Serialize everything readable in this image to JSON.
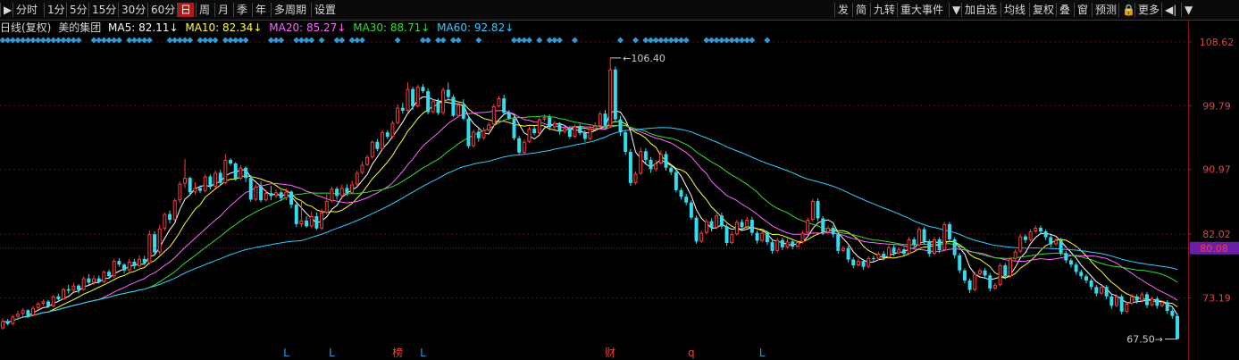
{
  "toolbar": {
    "left_items": [
      "分时",
      "1分",
      "5分",
      "15分",
      "30分",
      "60分",
      "日",
      "周",
      "月",
      "季",
      "年",
      "多周期",
      "设置"
    ],
    "active": "日",
    "right_items": [
      "发",
      "简",
      "九转",
      "重大事件",
      "加自选",
      "均线",
      "复权",
      "叠",
      "窗",
      "预测",
      "更多"
    ]
  },
  "info": {
    "period": "日线(复权)",
    "stock_name": "美的集团",
    "ma": [
      {
        "label": "MA5: 82.11↓",
        "color": "#ffffff"
      },
      {
        "label": "MA10: 82.34↓",
        "color": "#ffff33"
      },
      {
        "label": "MA20: 85.27↓",
        "color": "#ff66ff"
      },
      {
        "label": "MA30: 88.71↓",
        "color": "#33dd33"
      },
      {
        "label": "MA60: 92.82↓",
        "color": "#33ccff"
      }
    ]
  },
  "chart_data": {
    "type": "candlestick",
    "y_ticks": [
      "108.62",
      "99.79",
      "90.97",
      "82.02",
      "73.19"
    ],
    "ylim": [
      64.6,
      111.7
    ],
    "current_price": "80.08",
    "high_annotation": "106.40",
    "low_annotation": "67.50",
    "bottom_markers": [
      {
        "label": "L",
        "index": 56
      },
      {
        "label": "L",
        "index": 65
      },
      {
        "label": "榜",
        "index": 78
      },
      {
        "label": "L",
        "index": 83
      },
      {
        "label": "财",
        "index": 120
      },
      {
        "label": "q",
        "index": 136
      },
      {
        "label": "L",
        "index": 150
      }
    ],
    "diamond_indices": [
      0,
      1,
      2,
      3,
      4,
      5,
      6,
      7,
      8,
      9,
      10,
      11,
      12,
      13,
      14,
      15,
      18,
      19,
      20,
      21,
      22,
      23,
      25,
      26,
      27,
      28,
      29,
      33,
      34,
      35,
      36,
      37,
      39,
      40,
      41,
      42,
      44,
      45,
      46,
      47,
      48,
      53,
      54,
      55,
      58,
      59,
      60,
      61,
      63,
      66,
      67,
      69,
      70,
      71,
      78,
      83,
      84,
      86,
      87,
      89,
      90,
      94,
      101,
      102,
      103,
      104,
      106,
      108,
      109,
      110,
      113,
      122,
      125,
      127,
      128,
      129,
      130,
      131,
      132,
      133,
      134,
      135,
      139,
      140,
      141,
      142,
      143,
      144,
      145,
      146,
      147,
      148,
      151
    ],
    "candles": [
      [
        69.0,
        70.0,
        68.8,
        70.4
      ],
      [
        70.0,
        69.6,
        69.4,
        70.3
      ],
      [
        69.6,
        70.6,
        69.4,
        70.8
      ],
      [
        70.6,
        71.0,
        70.4,
        71.4
      ],
      [
        71.0,
        71.5,
        70.6,
        71.8
      ],
      [
        71.5,
        70.8,
        70.5,
        71.6
      ],
      [
        70.8,
        71.8,
        70.7,
        72.1
      ],
      [
        71.8,
        72.4,
        71.6,
        72.6
      ],
      [
        72.4,
        72.7,
        72.1,
        73.0
      ],
      [
        72.7,
        72.0,
        71.8,
        72.9
      ],
      [
        72.0,
        73.4,
        71.9,
        73.6
      ],
      [
        73.4,
        73.0,
        72.7,
        73.8
      ],
      [
        73.0,
        74.4,
        72.9,
        74.6
      ],
      [
        74.4,
        74.2,
        73.8,
        75.0
      ],
      [
        74.2,
        74.9,
        74.0,
        75.3
      ],
      [
        74.9,
        74.3,
        73.8,
        75.1
      ],
      [
        74.3,
        75.9,
        74.2,
        76.2
      ],
      [
        75.9,
        75.3,
        75.0,
        76.5
      ],
      [
        75.3,
        75.9,
        75.0,
        76.3
      ],
      [
        75.9,
        75.4,
        75.2,
        76.3
      ],
      [
        75.4,
        76.8,
        75.2,
        77.0
      ],
      [
        76.8,
        76.2,
        75.8,
        77.1
      ],
      [
        76.2,
        78.3,
        76.0,
        78.6
      ],
      [
        78.3,
        77.8,
        77.5,
        78.7
      ],
      [
        77.8,
        77.0,
        76.6,
        78.0
      ],
      [
        77.0,
        78.2,
        76.8,
        78.6
      ],
      [
        78.2,
        77.6,
        77.2,
        78.6
      ],
      [
        77.6,
        78.6,
        77.4,
        79.1
      ],
      [
        78.6,
        78.0,
        77.8,
        79.0
      ],
      [
        78.0,
        82.0,
        77.8,
        82.5
      ],
      [
        82.0,
        79.5,
        79.0,
        82.4
      ],
      [
        79.5,
        82.8,
        79.2,
        83.3
      ],
      [
        82.8,
        84.8,
        82.5,
        85.0
      ],
      [
        84.8,
        84.0,
        83.5,
        85.3
      ],
      [
        84.0,
        86.7,
        83.8,
        87.0
      ],
      [
        86.7,
        89.0,
        86.3,
        89.3
      ],
      [
        89.0,
        89.8,
        88.4,
        92.4
      ],
      [
        89.8,
        87.8,
        87.5,
        90.0
      ],
      [
        87.8,
        88.4,
        87.5,
        89.2
      ],
      [
        88.4,
        88.0,
        87.7,
        88.8
      ],
      [
        88.0,
        90.0,
        87.8,
        90.3
      ],
      [
        90.0,
        88.6,
        88.2,
        90.3
      ],
      [
        88.6,
        90.5,
        88.4,
        90.8
      ],
      [
        90.5,
        89.1,
        88.8,
        90.9
      ],
      [
        89.1,
        92.3,
        88.9,
        93.1
      ],
      [
        92.3,
        91.8,
        91.5,
        92.5
      ],
      [
        91.8,
        89.7,
        89.4,
        92.0
      ],
      [
        89.7,
        91.2,
        89.5,
        91.6
      ],
      [
        91.2,
        89.8,
        89.2,
        91.4
      ],
      [
        89.8,
        86.8,
        86.5,
        90.2
      ],
      [
        86.8,
        88.6,
        86.6,
        88.9
      ],
      [
        88.6,
        86.7,
        86.4,
        89.3
      ],
      [
        86.7,
        87.7,
        86.5,
        88.1
      ],
      [
        87.7,
        87.3,
        86.7,
        88.7
      ],
      [
        87.3,
        87.8,
        87.0,
        88.2
      ],
      [
        87.8,
        87.0,
        86.6,
        88.1
      ],
      [
        87.0,
        87.9,
        86.7,
        88.4
      ],
      [
        87.9,
        86.1,
        85.6,
        88.1
      ],
      [
        86.1,
        83.4,
        83.0,
        86.4
      ],
      [
        83.4,
        83.9,
        83.0,
        86.8
      ],
      [
        83.9,
        83.1,
        82.9,
        84.5
      ],
      [
        83.1,
        84.5,
        82.9,
        85.2
      ],
      [
        84.5,
        82.8,
        82.6,
        85.0
      ],
      [
        82.8,
        85.0,
        82.6,
        85.5
      ],
      [
        85.0,
        86.6,
        84.8,
        87.5
      ],
      [
        86.6,
        88.3,
        86.4,
        88.6
      ],
      [
        88.3,
        87.3,
        86.8,
        88.6
      ],
      [
        87.3,
        88.4,
        87.1,
        88.9
      ],
      [
        88.4,
        87.7,
        87.3,
        88.9
      ],
      [
        87.7,
        88.9,
        87.5,
        89.4
      ],
      [
        88.9,
        90.5,
        88.6,
        90.8
      ],
      [
        90.5,
        91.6,
        90.3,
        92.1
      ],
      [
        91.6,
        92.7,
        91.4,
        93.0
      ],
      [
        92.7,
        94.8,
        92.4,
        95.0
      ],
      [
        94.8,
        93.8,
        93.5,
        95.2
      ],
      [
        93.8,
        96.1,
        93.6,
        96.4
      ],
      [
        96.1,
        95.5,
        95.2,
        96.4
      ],
      [
        95.5,
        97.4,
        95.3,
        97.7
      ],
      [
        97.4,
        99.5,
        97.2,
        100.0
      ],
      [
        99.5,
        99.1,
        98.7,
        100.2
      ],
      [
        99.1,
        102.1,
        98.9,
        103.0
      ],
      [
        102.1,
        99.7,
        99.2,
        102.4
      ],
      [
        99.7,
        102.4,
        99.5,
        102.7
      ],
      [
        102.4,
        101.8,
        101.5,
        102.8
      ],
      [
        101.8,
        98.9,
        98.6,
        102.2
      ],
      [
        98.9,
        100.4,
        98.7,
        100.7
      ],
      [
        100.4,
        98.8,
        98.5,
        100.8
      ],
      [
        98.8,
        102.0,
        98.5,
        102.3
      ],
      [
        102.0,
        101.0,
        100.6,
        103.0
      ],
      [
        101.0,
        98.4,
        98.2,
        101.3
      ],
      [
        98.4,
        99.9,
        98.2,
        100.2
      ],
      [
        99.9,
        98.0,
        97.8,
        100.7
      ],
      [
        98.0,
        94.2,
        93.9,
        98.3
      ],
      [
        94.2,
        96.2,
        94.0,
        96.5
      ],
      [
        96.2,
        95.3,
        94.8,
        96.6
      ],
      [
        95.3,
        96.4,
        95.1,
        96.8
      ],
      [
        96.4,
        97.2,
        96.2,
        97.5
      ],
      [
        97.2,
        99.7,
        97.0,
        100.0
      ],
      [
        99.7,
        100.8,
        99.5,
        101.1
      ],
      [
        100.8,
        98.8,
        98.5,
        101.3
      ],
      [
        98.8,
        98.0,
        97.8,
        99.2
      ],
      [
        98.0,
        95.3,
        95.0,
        98.3
      ],
      [
        95.3,
        93.3,
        93.0,
        95.6
      ],
      [
        93.3,
        94.8,
        93.1,
        95.1
      ],
      [
        94.8,
        96.6,
        94.6,
        96.9
      ],
      [
        96.6,
        96.0,
        95.7,
        97.0
      ],
      [
        96.0,
        97.9,
        95.8,
        98.2
      ],
      [
        97.9,
        98.2,
        97.6,
        98.6
      ],
      [
        98.2,
        96.8,
        96.4,
        98.6
      ],
      [
        96.8,
        97.4,
        96.5,
        97.7
      ],
      [
        97.4,
        96.2,
        95.8,
        97.5
      ],
      [
        96.2,
        96.7,
        95.9,
        97.0
      ],
      [
        96.7,
        95.5,
        95.2,
        96.9
      ],
      [
        95.5,
        96.9,
        95.3,
        97.2
      ],
      [
        96.9,
        96.0,
        95.7,
        97.3
      ],
      [
        96.0,
        95.2,
        94.8,
        96.4
      ],
      [
        95.2,
        96.6,
        95.0,
        97.0
      ],
      [
        96.6,
        97.0,
        96.4,
        97.5
      ],
      [
        97.0,
        98.7,
        96.7,
        99.0
      ],
      [
        98.7,
        97.0,
        96.8,
        99.2
      ],
      [
        97.0,
        104.8,
        96.7,
        106.4
      ],
      [
        104.8,
        97.9,
        97.5,
        105.2
      ],
      [
        97.9,
        96.1,
        95.6,
        98.4
      ],
      [
        96.1,
        93.4,
        93.0,
        96.4
      ],
      [
        93.4,
        89.1,
        88.7,
        93.8
      ],
      [
        89.1,
        90.4,
        88.9,
        90.7
      ],
      [
        90.4,
        93.5,
        90.2,
        94.0
      ],
      [
        93.5,
        92.3,
        91.8,
        93.9
      ],
      [
        92.3,
        91.0,
        90.5,
        92.7
      ],
      [
        91.0,
        91.8,
        90.7,
        92.3
      ],
      [
        91.8,
        93.1,
        91.6,
        93.6
      ],
      [
        93.1,
        91.2,
        90.8,
        93.5
      ],
      [
        91.2,
        90.6,
        90.2,
        91.6
      ],
      [
        90.6,
        88.1,
        87.8,
        90.9
      ],
      [
        88.1,
        87.2,
        86.8,
        88.4
      ],
      [
        87.2,
        86.4,
        86.0,
        87.6
      ],
      [
        86.4,
        84.3,
        84.0,
        86.7
      ],
      [
        84.3,
        81.0,
        80.7,
        84.6
      ],
      [
        81.0,
        82.2,
        80.8,
        82.5
      ],
      [
        82.2,
        83.8,
        82.0,
        84.1
      ],
      [
        83.8,
        82.9,
        82.4,
        84.2
      ],
      [
        82.9,
        84.6,
        82.7,
        84.9
      ],
      [
        84.6,
        83.1,
        82.7,
        85.0
      ],
      [
        83.1,
        80.8,
        80.4,
        83.4
      ],
      [
        80.8,
        82.0,
        80.6,
        82.4
      ],
      [
        82.0,
        83.7,
        81.8,
        84.0
      ],
      [
        83.7,
        83.0,
        82.6,
        84.1
      ],
      [
        83.0,
        84.0,
        82.8,
        84.4
      ],
      [
        84.0,
        82.2,
        81.8,
        84.4
      ],
      [
        82.2,
        81.1,
        80.7,
        82.5
      ],
      [
        81.1,
        82.2,
        80.9,
        82.6
      ],
      [
        82.2,
        80.9,
        80.5,
        82.5
      ],
      [
        80.9,
        79.7,
        79.3,
        81.2
      ],
      [
        79.7,
        81.2,
        79.5,
        81.5
      ],
      [
        81.2,
        80.2,
        79.8,
        81.5
      ],
      [
        80.2,
        81.0,
        80.0,
        81.4
      ],
      [
        81.0,
        80.3,
        79.9,
        81.3
      ],
      [
        80.3,
        80.9,
        80.1,
        81.2
      ],
      [
        80.9,
        82.2,
        80.7,
        82.5
      ],
      [
        82.2,
        84.0,
        82.0,
        84.3
      ],
      [
        84.0,
        86.6,
        83.8,
        86.9
      ],
      [
        86.6,
        84.2,
        83.8,
        87.0
      ],
      [
        84.2,
        82.3,
        81.9,
        84.5
      ],
      [
        82.3,
        82.9,
        82.1,
        83.2
      ],
      [
        82.9,
        82.0,
        81.6,
        83.2
      ],
      [
        82.0,
        79.7,
        79.3,
        82.3
      ],
      [
        79.7,
        80.1,
        79.5,
        80.4
      ],
      [
        80.1,
        78.5,
        78.1,
        80.4
      ],
      [
        78.5,
        77.7,
        77.3,
        78.8
      ],
      [
        77.7,
        78.3,
        77.5,
        78.6
      ],
      [
        78.3,
        77.5,
        77.1,
        78.6
      ],
      [
        77.5,
        78.7,
        77.3,
        79.0
      ],
      [
        78.7,
        78.6,
        78.2,
        79.0
      ],
      [
        78.6,
        79.3,
        78.4,
        79.6
      ],
      [
        79.3,
        78.8,
        78.4,
        79.7
      ],
      [
        78.8,
        80.2,
        78.6,
        80.5
      ],
      [
        80.2,
        79.4,
        79.0,
        80.5
      ],
      [
        79.4,
        79.9,
        79.2,
        80.2
      ],
      [
        79.9,
        79.3,
        78.9,
        80.2
      ],
      [
        79.3,
        81.3,
        79.1,
        81.6
      ],
      [
        81.3,
        80.5,
        80.1,
        81.6
      ],
      [
        80.5,
        82.7,
        80.3,
        83.0
      ],
      [
        82.7,
        81.0,
        80.6,
        83.0
      ],
      [
        81.0,
        79.3,
        78.9,
        81.3
      ],
      [
        79.3,
        81.3,
        79.1,
        81.6
      ],
      [
        81.3,
        79.8,
        79.4,
        81.6
      ],
      [
        79.8,
        83.4,
        79.6,
        83.7
      ],
      [
        83.4,
        81.3,
        80.9,
        83.7
      ],
      [
        81.3,
        79.1,
        78.7,
        81.6
      ],
      [
        79.1,
        77.0,
        76.6,
        79.4
      ],
      [
        77.0,
        75.6,
        75.2,
        77.3
      ],
      [
        75.6,
        74.3,
        73.9,
        75.9
      ],
      [
        74.3,
        76.5,
        74.1,
        76.8
      ],
      [
        76.5,
        77.0,
        76.3,
        77.3
      ],
      [
        77.0,
        76.3,
        75.9,
        77.3
      ],
      [
        76.3,
        74.5,
        74.1,
        76.6
      ],
      [
        74.5,
        75.0,
        74.3,
        75.3
      ],
      [
        75.0,
        77.7,
        74.8,
        78.0
      ],
      [
        77.7,
        76.2,
        75.8,
        78.0
      ],
      [
        76.2,
        78.6,
        76.0,
        78.9
      ],
      [
        78.6,
        79.6,
        78.4,
        79.9
      ],
      [
        79.6,
        81.7,
        79.4,
        82.0
      ],
      [
        81.7,
        81.2,
        80.8,
        82.0
      ],
      [
        81.2,
        82.4,
        81.0,
        82.7
      ],
      [
        82.4,
        82.9,
        82.2,
        83.2
      ],
      [
        82.9,
        82.4,
        82.0,
        83.2
      ],
      [
        82.4,
        81.6,
        81.2,
        82.7
      ],
      [
        81.6,
        80.6,
        80.2,
        81.9
      ],
      [
        80.6,
        81.2,
        80.4,
        81.5
      ],
      [
        81.2,
        79.4,
        79.0,
        81.5
      ],
      [
        79.4,
        78.4,
        78.0,
        79.7
      ],
      [
        78.4,
        77.8,
        77.4,
        78.7
      ],
      [
        77.8,
        76.8,
        76.4,
        78.1
      ],
      [
        76.8,
        76.2,
        75.8,
        77.1
      ],
      [
        76.2,
        75.6,
        75.2,
        76.5
      ],
      [
        75.6,
        74.7,
        74.3,
        75.9
      ],
      [
        74.7,
        73.8,
        73.4,
        75.0
      ],
      [
        73.8,
        74.7,
        73.6,
        75.0
      ],
      [
        74.7,
        73.4,
        73.0,
        75.0
      ],
      [
        73.4,
        72.1,
        71.7,
        73.7
      ],
      [
        72.1,
        73.4,
        71.9,
        73.7
      ],
      [
        73.4,
        71.3,
        70.9,
        73.7
      ],
      [
        71.3,
        72.4,
        71.1,
        72.7
      ],
      [
        72.4,
        73.4,
        72.2,
        73.7
      ],
      [
        73.4,
        72.8,
        72.4,
        73.7
      ],
      [
        72.8,
        73.7,
        72.6,
        74.0
      ],
      [
        73.7,
        72.2,
        71.8,
        74.0
      ],
      [
        72.2,
        73.1,
        72.0,
        73.4
      ],
      [
        73.1,
        72.1,
        71.7,
        73.4
      ],
      [
        72.1,
        72.6,
        71.9,
        72.9
      ],
      [
        72.6,
        71.4,
        71.0,
        72.9
      ],
      [
        71.4,
        70.7,
        70.3,
        71.7
      ],
      [
        70.7,
        67.5,
        67.5,
        71.0
      ]
    ]
  }
}
